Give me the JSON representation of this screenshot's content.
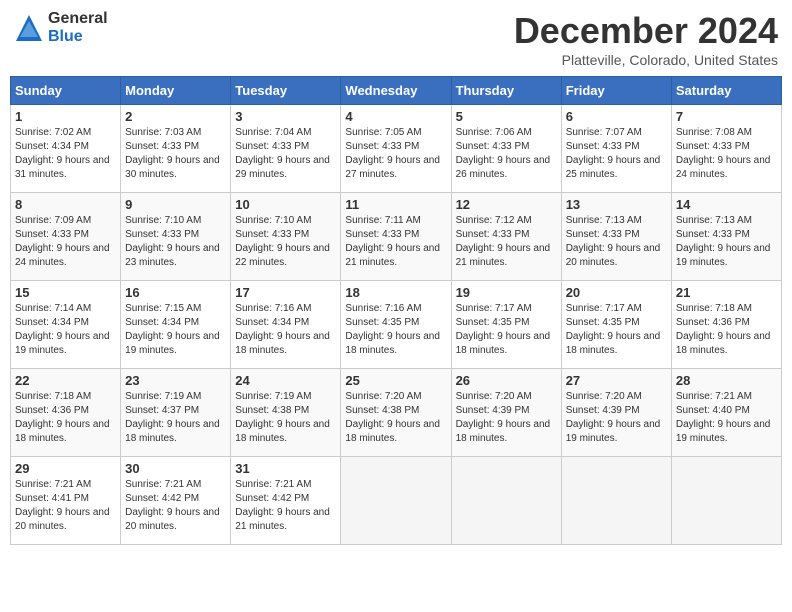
{
  "header": {
    "logo": {
      "general": "General",
      "blue": "Blue"
    },
    "title": "December 2024",
    "location": "Platteville, Colorado, United States"
  },
  "weekdays": [
    "Sunday",
    "Monday",
    "Tuesday",
    "Wednesday",
    "Thursday",
    "Friday",
    "Saturday"
  ],
  "weeks": [
    [
      {
        "day": 1,
        "sunrise": "7:02 AM",
        "sunset": "4:34 PM",
        "daylight": "9 hours and 31 minutes."
      },
      {
        "day": 2,
        "sunrise": "7:03 AM",
        "sunset": "4:33 PM",
        "daylight": "9 hours and 30 minutes."
      },
      {
        "day": 3,
        "sunrise": "7:04 AM",
        "sunset": "4:33 PM",
        "daylight": "9 hours and 29 minutes."
      },
      {
        "day": 4,
        "sunrise": "7:05 AM",
        "sunset": "4:33 PM",
        "daylight": "9 hours and 27 minutes."
      },
      {
        "day": 5,
        "sunrise": "7:06 AM",
        "sunset": "4:33 PM",
        "daylight": "9 hours and 26 minutes."
      },
      {
        "day": 6,
        "sunrise": "7:07 AM",
        "sunset": "4:33 PM",
        "daylight": "9 hours and 25 minutes."
      },
      {
        "day": 7,
        "sunrise": "7:08 AM",
        "sunset": "4:33 PM",
        "daylight": "9 hours and 24 minutes."
      }
    ],
    [
      {
        "day": 8,
        "sunrise": "7:09 AM",
        "sunset": "4:33 PM",
        "daylight": "9 hours and 24 minutes."
      },
      {
        "day": 9,
        "sunrise": "7:10 AM",
        "sunset": "4:33 PM",
        "daylight": "9 hours and 23 minutes."
      },
      {
        "day": 10,
        "sunrise": "7:10 AM",
        "sunset": "4:33 PM",
        "daylight": "9 hours and 22 minutes."
      },
      {
        "day": 11,
        "sunrise": "7:11 AM",
        "sunset": "4:33 PM",
        "daylight": "9 hours and 21 minutes."
      },
      {
        "day": 12,
        "sunrise": "7:12 AM",
        "sunset": "4:33 PM",
        "daylight": "9 hours and 21 minutes."
      },
      {
        "day": 13,
        "sunrise": "7:13 AM",
        "sunset": "4:33 PM",
        "daylight": "9 hours and 20 minutes."
      },
      {
        "day": 14,
        "sunrise": "7:13 AM",
        "sunset": "4:33 PM",
        "daylight": "9 hours and 19 minutes."
      }
    ],
    [
      {
        "day": 15,
        "sunrise": "7:14 AM",
        "sunset": "4:34 PM",
        "daylight": "9 hours and 19 minutes."
      },
      {
        "day": 16,
        "sunrise": "7:15 AM",
        "sunset": "4:34 PM",
        "daylight": "9 hours and 19 minutes."
      },
      {
        "day": 17,
        "sunrise": "7:16 AM",
        "sunset": "4:34 PM",
        "daylight": "9 hours and 18 minutes."
      },
      {
        "day": 18,
        "sunrise": "7:16 AM",
        "sunset": "4:35 PM",
        "daylight": "9 hours and 18 minutes."
      },
      {
        "day": 19,
        "sunrise": "7:17 AM",
        "sunset": "4:35 PM",
        "daylight": "9 hours and 18 minutes."
      },
      {
        "day": 20,
        "sunrise": "7:17 AM",
        "sunset": "4:35 PM",
        "daylight": "9 hours and 18 minutes."
      },
      {
        "day": 21,
        "sunrise": "7:18 AM",
        "sunset": "4:36 PM",
        "daylight": "9 hours and 18 minutes."
      }
    ],
    [
      {
        "day": 22,
        "sunrise": "7:18 AM",
        "sunset": "4:36 PM",
        "daylight": "9 hours and 18 minutes."
      },
      {
        "day": 23,
        "sunrise": "7:19 AM",
        "sunset": "4:37 PM",
        "daylight": "9 hours and 18 minutes."
      },
      {
        "day": 24,
        "sunrise": "7:19 AM",
        "sunset": "4:38 PM",
        "daylight": "9 hours and 18 minutes."
      },
      {
        "day": 25,
        "sunrise": "7:20 AM",
        "sunset": "4:38 PM",
        "daylight": "9 hours and 18 minutes."
      },
      {
        "day": 26,
        "sunrise": "7:20 AM",
        "sunset": "4:39 PM",
        "daylight": "9 hours and 18 minutes."
      },
      {
        "day": 27,
        "sunrise": "7:20 AM",
        "sunset": "4:39 PM",
        "daylight": "9 hours and 19 minutes."
      },
      {
        "day": 28,
        "sunrise": "7:21 AM",
        "sunset": "4:40 PM",
        "daylight": "9 hours and 19 minutes."
      }
    ],
    [
      {
        "day": 29,
        "sunrise": "7:21 AM",
        "sunset": "4:41 PM",
        "daylight": "9 hours and 20 minutes."
      },
      {
        "day": 30,
        "sunrise": "7:21 AM",
        "sunset": "4:42 PM",
        "daylight": "9 hours and 20 minutes."
      },
      {
        "day": 31,
        "sunrise": "7:21 AM",
        "sunset": "4:42 PM",
        "daylight": "9 hours and 21 minutes."
      },
      null,
      null,
      null,
      null
    ]
  ]
}
